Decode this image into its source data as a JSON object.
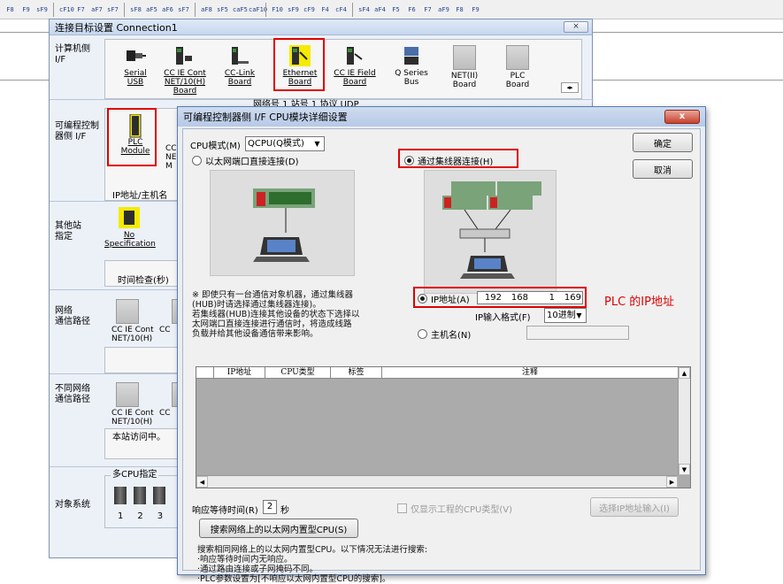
{
  "toolbar": {
    "buttons": [
      "F8",
      "F9",
      "sF9",
      "cF10",
      "F7",
      "aF7",
      "sF7",
      "sF8",
      "aF5",
      "aF6",
      "sF7",
      "aF8",
      "sF5",
      "caF5",
      "caF10",
      "F10",
      "sF9",
      "cF9",
      "F4",
      "cF4",
      "sF4",
      "aF4",
      "F5",
      "F6",
      "F7",
      "aF9",
      "F8",
      "F9"
    ]
  },
  "back": {
    "title": "连接目标设置 Connection1",
    "close": "⨯",
    "rows": {
      "pc_side": "计算机侧\nI/F",
      "plc_side": "可编程控制\n器侧 I/F",
      "other_station": "其他站\n指定",
      "network_route": "网络\n通信路径",
      "diff_network": "不同网络\n通信路径",
      "target_system": "对象系统"
    },
    "pc_icons": [
      {
        "label": "Serial\nUSB"
      },
      {
        "label": "CC IE Cont\nNET/10(H)\nBoard"
      },
      {
        "label": "CC-Link\nBoard"
      },
      {
        "label": "Ethernet\nBoard"
      },
      {
        "label": "CC IE Field\nBoard"
      },
      {
        "label": "Q Series\nBus"
      },
      {
        "label": "NET(II)\nBoard"
      },
      {
        "label": "PLC\nBoard"
      }
    ],
    "net_row": "网络号  1   站号  1   协议  UDP",
    "plc_module": "PLC\nModule",
    "plc_module_2": "CC\nNE\nM",
    "ip_hostname": "IP地址/主机名",
    "no_spec": "No Specification",
    "time_check": "时间检查(秒)",
    "cc_ie_cont": "CC IE Cont\nNET/10(H)",
    "cc_short": "CC",
    "local_access": "本站访问中。",
    "multi_cpu": "多CPU指定",
    "cpu_numbers": [
      "1",
      "2",
      "3"
    ]
  },
  "dialog": {
    "title": "可编程控制器侧 I/F CPU模块详细设置",
    "close": "x",
    "cpu_mode_label": "CPU模式(M)",
    "cpu_mode_value": "QCPU(Q模式)",
    "ok": "确定",
    "cancel": "取消",
    "direct_connect": "以太网端口直接连接(D)",
    "hub_connect": "通过集线器连接(H)",
    "ip_address_label": "IP地址(A)",
    "ip": [
      "192",
      "168",
      "1",
      "169"
    ],
    "ip_format_label": "IP输入格式(F)",
    "ip_format_value": "10进制",
    "host_label": "主机名(N)",
    "annotation": "PLC 的IP地址",
    "note": "※ 即使只有一台通信对象机器，通过集线器\n(HUB)时请选择通过集线器连接)。\n若集线器(HUB)连接其他设备的状态下选择以\n太网端口直接连接进行通信时，将造成线路\n负载并给其他设备通信带来影响。",
    "columns": [
      "IP地址",
      "CPU类型",
      "标签",
      "注释"
    ],
    "wait_label": "响应等待时间(R)",
    "wait_value": "2",
    "wait_unit": "秒",
    "show_only": "仅显示工程的CPU类型(V)",
    "select_ip_btn": "选择IP地址输入(I)",
    "search_btn": "搜索网络上的以太网内置型CPU(S)",
    "search_note": "搜索相同网络上的以太网内置型CPU。以下情况无法进行搜索:\n·响应等待时间内无响应。\n·通过路由连接或子网掩码不同。\n·PLC参数设置为[不响应以太网内置型CPU的搜索]。"
  },
  "colors": {
    "highlight": "#e00000",
    "annotation": "#e00000",
    "yellow_icon": "#f5ea00"
  }
}
